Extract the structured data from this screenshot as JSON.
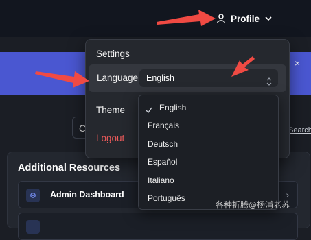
{
  "header": {
    "profile_label": "Profile",
    "profile_icon": "user-icon",
    "chevron_icon": "chevron-down-icon"
  },
  "banner": {
    "close_glyph": "×"
  },
  "background": {
    "search_partial": "C",
    "search_link": "Search"
  },
  "resources": {
    "title": "Additional Resources",
    "items": [
      {
        "label": "Admin Dashboard",
        "icon": "gear-icon"
      },
      {
        "label": "",
        "icon": "box-icon"
      }
    ]
  },
  "menu": {
    "settings": "Settings",
    "language_label": "Language",
    "language_selected": "English",
    "theme": "Theme",
    "logout": "Logout"
  },
  "language_options": [
    "English",
    "Français",
    "Deutsch",
    "Español",
    "Italiano",
    "Português"
  ],
  "selected_language_index": 0,
  "watermark": "各种折腾@杨浦老苏",
  "colors": {
    "header_bg": "#12161f",
    "page_bg": "#1b1e25",
    "banner_bg": "#4a57d1",
    "menu_bg": "#25282e",
    "logout_red": "#ef5b5b",
    "annotation_arrow": "#f04a43"
  }
}
